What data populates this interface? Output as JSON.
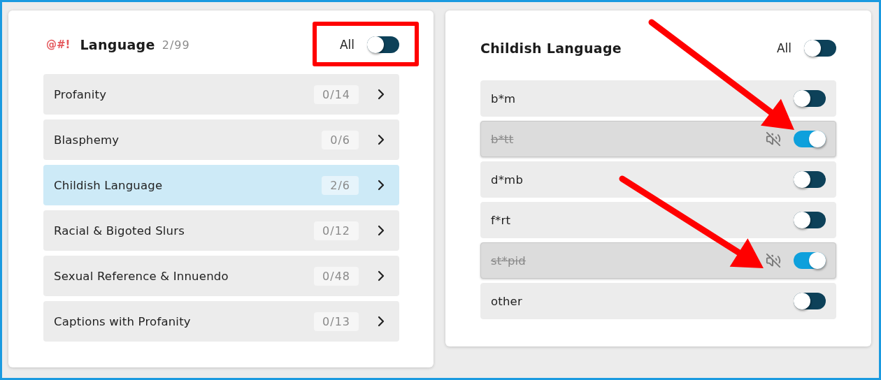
{
  "language_panel": {
    "icon_text": "@#!",
    "title": "Language",
    "count": "2/99",
    "all_label": "All",
    "all_on": false,
    "categories": [
      {
        "label": "Profanity",
        "count": "0/14",
        "selected": false
      },
      {
        "label": "Blasphemy",
        "count": "0/6",
        "selected": false
      },
      {
        "label": "Childish Language",
        "count": "2/6",
        "selected": true
      },
      {
        "label": "Racial & Bigoted Slurs",
        "count": "0/12",
        "selected": false
      },
      {
        "label": "Sexual Reference & Innuendo",
        "count": "0/48",
        "selected": false
      },
      {
        "label": "Captions with Profanity",
        "count": "0/13",
        "selected": false
      }
    ]
  },
  "detail_panel": {
    "title": "Childish Language",
    "all_label": "All",
    "all_on": false,
    "words": [
      {
        "label": "b*m",
        "on": false,
        "muted": false
      },
      {
        "label": "b*tt",
        "on": true,
        "muted": true
      },
      {
        "label": "d*mb",
        "on": false,
        "muted": false
      },
      {
        "label": "f*rt",
        "on": false,
        "muted": false
      },
      {
        "label": "st*pid",
        "on": true,
        "muted": true
      },
      {
        "label": "other",
        "on": false,
        "muted": false
      }
    ]
  }
}
